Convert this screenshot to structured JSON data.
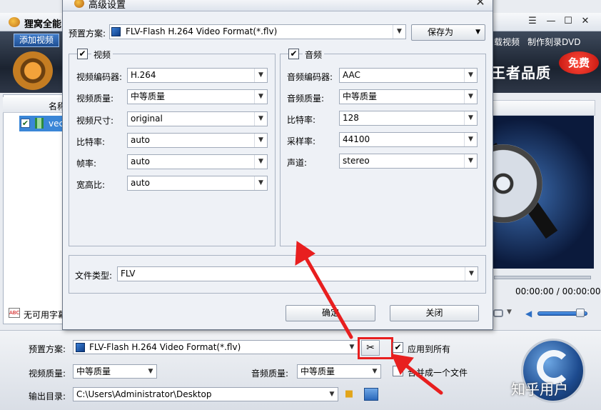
{
  "main_window": {
    "title": "狸窝全能",
    "add_video_label": "添加视频",
    "nav_download": "载视频",
    "nav_dvd": "制作刻录DVD",
    "slogan": "王者品质",
    "free_badge": "免费",
    "window_controls": {
      "menu": "☰",
      "minimize": "—",
      "maximize": "☐",
      "close": "✕"
    },
    "file_list": {
      "header_name": "名称",
      "rows": [
        {
          "name": "vec",
          "checked": true
        }
      ],
      "subtitle_label": "无可用字幕"
    },
    "player": {
      "time": "00:00:00 / 00:00:00",
      "volume_fraction": 0.85
    },
    "bottom": {
      "preset_label": "预置方案:",
      "preset_value": "FLV-Flash H.264 Video Format(*.flv)",
      "apply_all_label": "应用到所有",
      "apply_all_checked": true,
      "video_quality_label": "视频质量:",
      "video_quality_value": "中等质量",
      "audio_quality_label": "音频质量:",
      "audio_quality_value": "中等质量",
      "merge_label": "合并成一个文件",
      "merge_checked": false,
      "output_label": "输出目录:",
      "output_value": "C:\\Users\\Administrator\\Desktop"
    },
    "watermark": "知乎用户"
  },
  "dialog": {
    "title": "高级设置",
    "close_glyph": "✕",
    "preset_label": "预置方案:",
    "preset_value": "FLV-Flash H.264 Video Format(*.flv)",
    "save_as_label": "保存为",
    "video_group": {
      "title": "视频",
      "checked": true,
      "fields": [
        {
          "label": "视频编码器:",
          "value": "H.264"
        },
        {
          "label": "视频质量:",
          "value": "中等质量"
        },
        {
          "label": "视频尺寸:",
          "value": "original"
        },
        {
          "label": "比特率:",
          "value": "auto"
        },
        {
          "label": "帧率:",
          "value": "auto"
        },
        {
          "label": "宽高比:",
          "value": "auto"
        }
      ]
    },
    "audio_group": {
      "title": "音频",
      "checked": true,
      "fields": [
        {
          "label": "音频编码器:",
          "value": "AAC"
        },
        {
          "label": "音频质量:",
          "value": "中等质量"
        },
        {
          "label": "比特率:",
          "value": "128"
        },
        {
          "label": "采样率:",
          "value": "44100"
        },
        {
          "label": "声道:",
          "value": "stereo"
        }
      ]
    },
    "file_type_label": "文件类型:",
    "file_type_value": "FLV",
    "ok_label": "确定",
    "close_label": "关闭"
  },
  "colors": {
    "annotation_red": "#e81f1f",
    "selection_blue": "#3a86d7"
  },
  "icons": [
    "settings-icon",
    "folder-icon",
    "open-folder-icon",
    "camera-icon",
    "volume-icon",
    "convert-icon"
  ]
}
